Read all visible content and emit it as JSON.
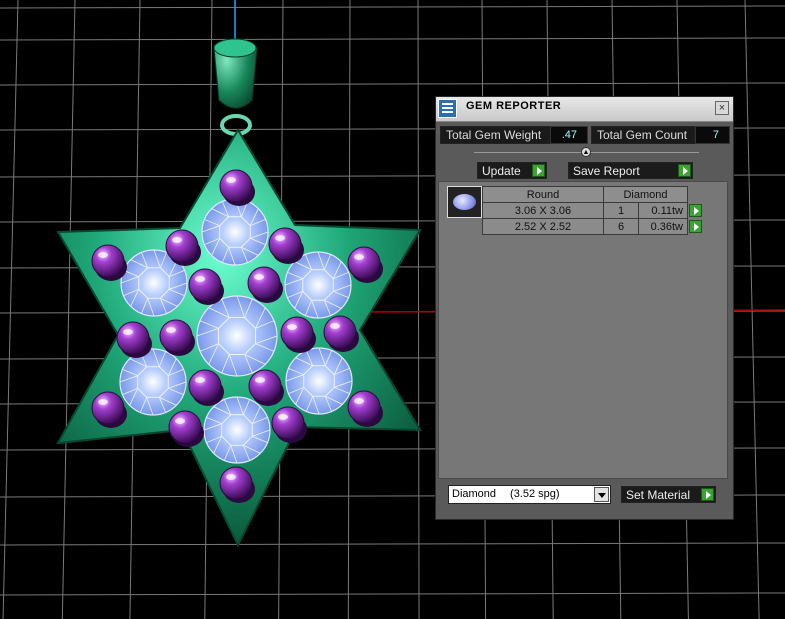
{
  "panel": {
    "title": "GEM REPORTER",
    "close_label": "×",
    "total_weight_label": "Total Gem Weight",
    "total_weight_value": ".47",
    "total_count_label": "Total Gem Count",
    "total_count_value": "7",
    "update_label": "Update",
    "save_report_label": "Save Report",
    "divider_knob": "▲"
  },
  "report": {
    "columns": [
      "Round",
      "Diamond"
    ],
    "rows": [
      {
        "size": "3.06 X 3.06",
        "count": "1",
        "weight": "0.11tw"
      },
      {
        "size": "2.52 X 2.52",
        "count": "6",
        "weight": "0.36tw"
      }
    ]
  },
  "material": {
    "selected_name": "Diamond",
    "selected_spg": "(3.52 spg)",
    "set_label": "Set Material"
  },
  "colors": {
    "grid_line": "#7a7a7a",
    "x_axis": "#b00000",
    "y_axis": "#2aa3ff",
    "metal": "#1f9e72",
    "amethyst": "#8a2fb4",
    "diamond": "#8fb2ff",
    "accent_button": "#3aa332"
  }
}
